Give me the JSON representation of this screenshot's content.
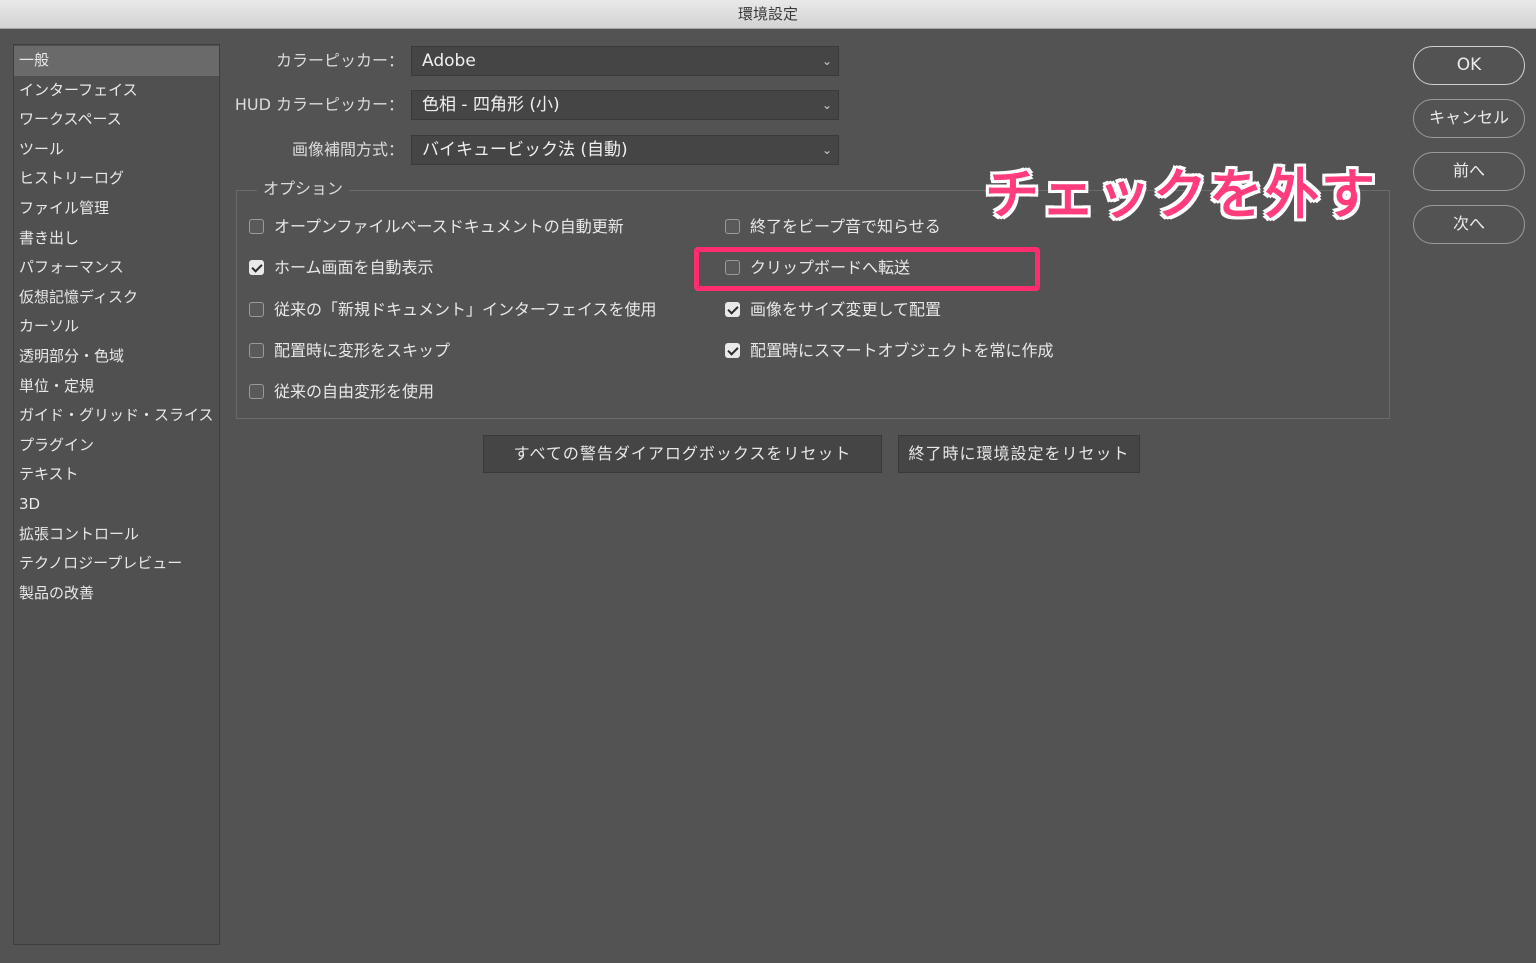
{
  "window": {
    "title": "環境設定"
  },
  "sidebar": {
    "items": [
      {
        "label": "一般",
        "selected": true
      },
      {
        "label": "インターフェイス"
      },
      {
        "label": "ワークスペース"
      },
      {
        "label": "ツール"
      },
      {
        "label": "ヒストリーログ"
      },
      {
        "label": "ファイル管理"
      },
      {
        "label": "書き出し"
      },
      {
        "label": "パフォーマンス"
      },
      {
        "label": "仮想記憶ディスク"
      },
      {
        "label": "カーソル"
      },
      {
        "label": "透明部分・色域"
      },
      {
        "label": "単位・定規"
      },
      {
        "label": "ガイド・グリッド・スライス"
      },
      {
        "label": "プラグイン"
      },
      {
        "label": "テキスト"
      },
      {
        "label": "3D"
      },
      {
        "label": "拡張コントロール"
      },
      {
        "label": "テクノロジープレビュー"
      },
      {
        "label": "製品の改善"
      }
    ]
  },
  "fields": {
    "color_picker": {
      "label": "カラーピッカー：",
      "value": "Adobe"
    },
    "hud_color_picker": {
      "label": "HUD カラーピッカー：",
      "value": "色相 - 四角形 (小)"
    },
    "interpolation": {
      "label": "画像補間方式：",
      "value": "バイキュービック法 (自動)"
    }
  },
  "options": {
    "legend": "オプション",
    "left": [
      {
        "label": "オープンファイルベースドキュメントの自動更新",
        "checked": false
      },
      {
        "label": "ホーム画面を自動表示",
        "checked": true
      },
      {
        "label": "従来の「新規ドキュメント」インターフェイスを使用",
        "checked": false
      },
      {
        "label": "配置時に変形をスキップ",
        "checked": false
      },
      {
        "label": "従来の自由変形を使用",
        "checked": false
      }
    ],
    "right": [
      {
        "label": "終了をビープ音で知らせる",
        "checked": false
      },
      {
        "label": "クリップボードへ転送",
        "checked": false
      },
      {
        "label": "画像をサイズ変更して配置",
        "checked": true
      },
      {
        "label": "配置時にスマートオブジェクトを常に作成",
        "checked": true
      }
    ]
  },
  "reset_buttons": {
    "reset_warnings": "すべての警告ダイアログボックスをリセット",
    "reset_on_quit": "終了時に環境設定をリセット"
  },
  "dialog_buttons": {
    "ok": "OK",
    "cancel": "キャンセル",
    "prev": "前へ",
    "next": "次へ"
  },
  "annotation": {
    "text": "チェックを外す",
    "color": "#ff3d7d"
  }
}
